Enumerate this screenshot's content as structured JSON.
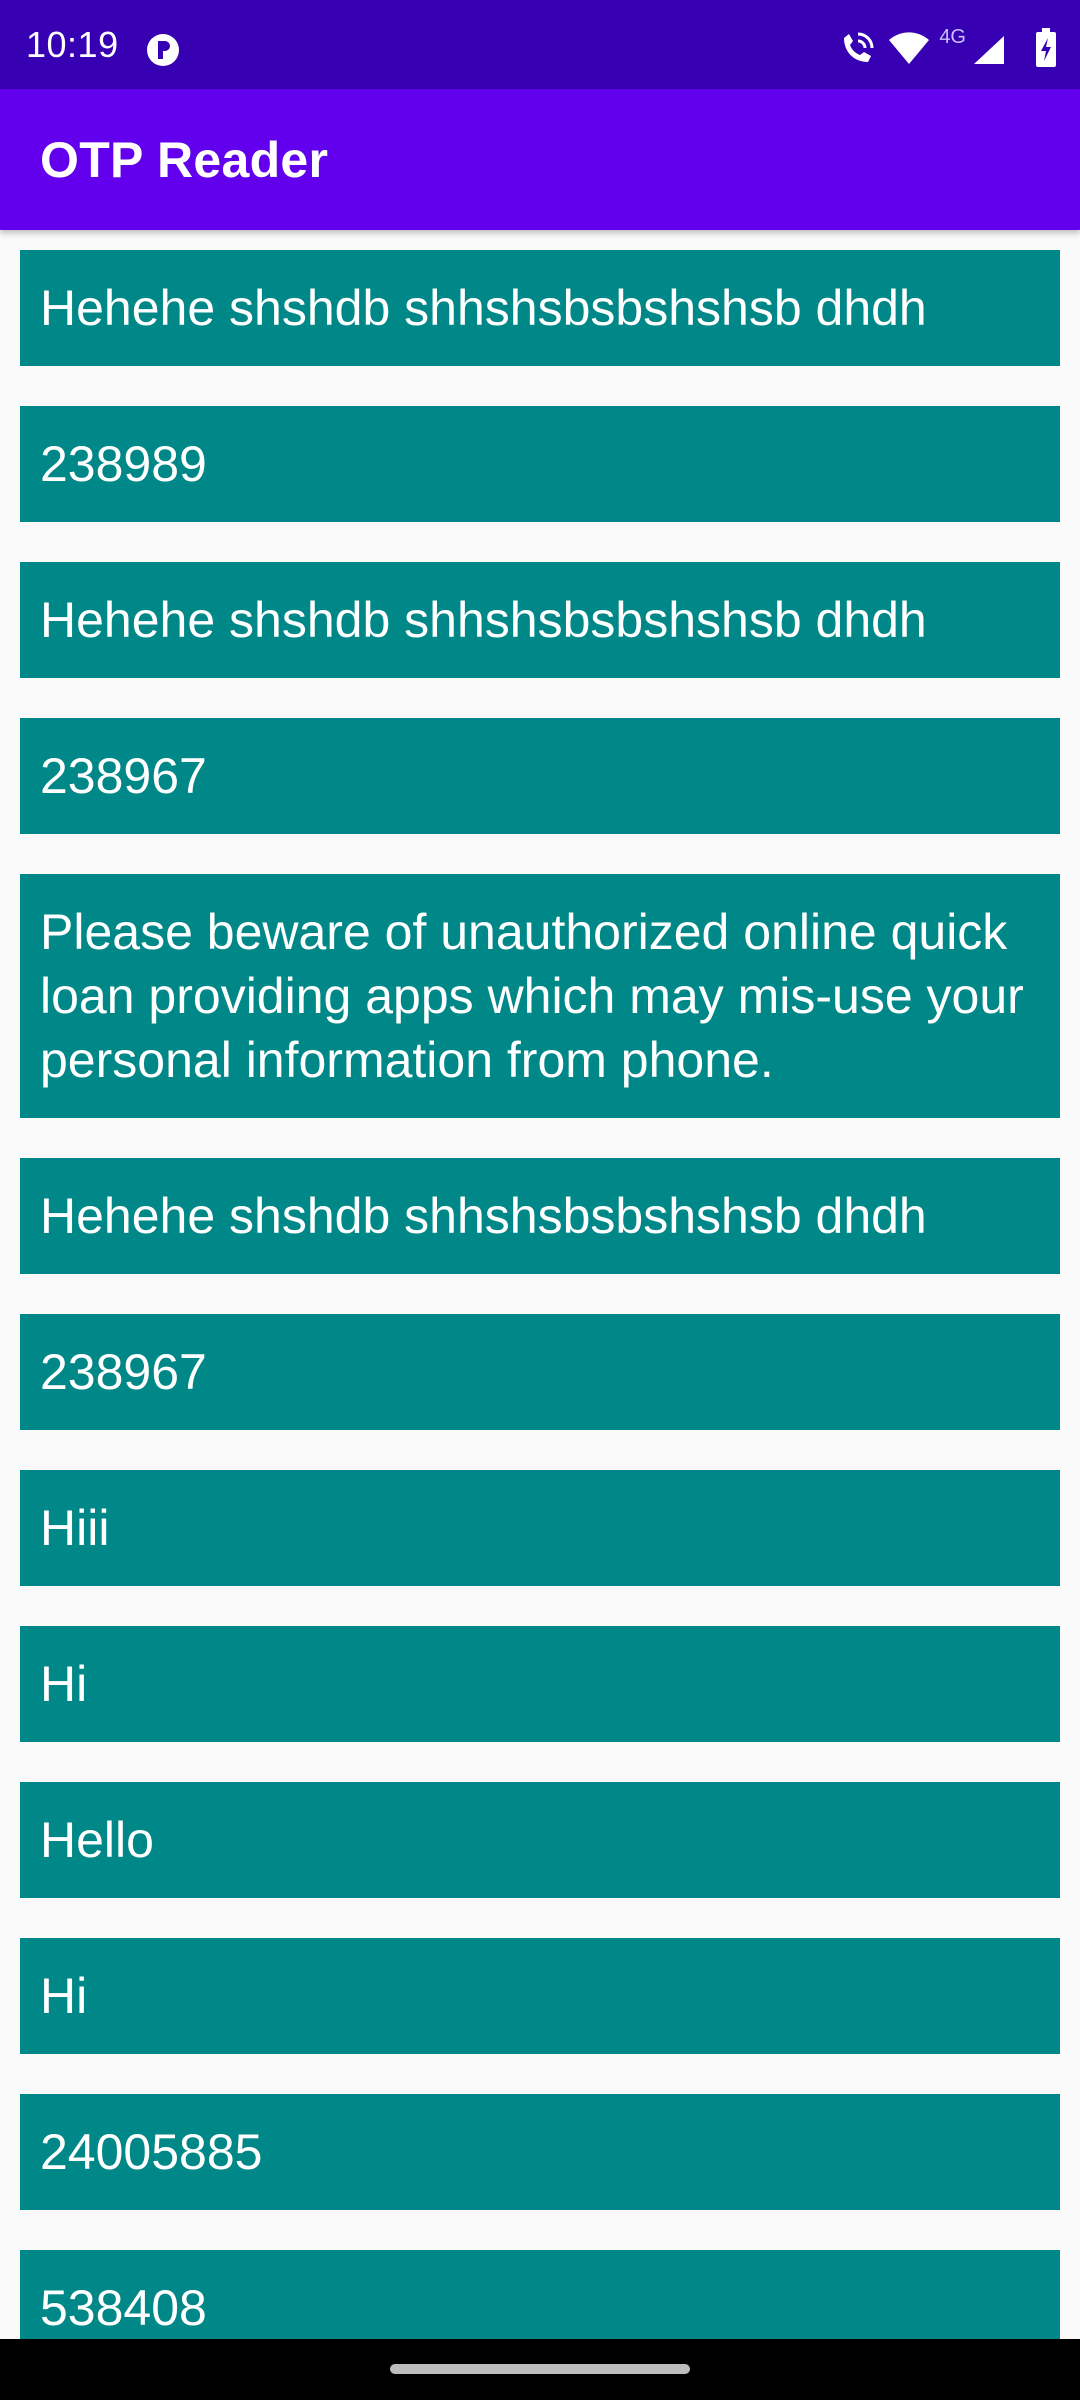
{
  "status_bar": {
    "time": "10:19",
    "network_label": "4G",
    "icons": [
      "play-protect-icon",
      "wifi-calling-icon",
      "wifi-icon",
      "cell-signal-icon",
      "battery-charging-icon"
    ]
  },
  "app_bar": {
    "title": "OTP Reader",
    "background_color": "#6200ee",
    "status_color": "#3700b3"
  },
  "messages": {
    "item_color": "#008888",
    "items": [
      "Hehehe shshdb shhshsbsbshshsb dhdh",
      "238989",
      "Hehehe shshdb shhshsbsbshshsb dhdh",
      "238967",
      "Please beware of unauthorized online quick loan providing apps which may mis-use your personal information from phone.",
      "Hehehe shshdb shhshsbsbshshsb dhdh",
      "238967",
      "Hiii",
      "Hi",
      "Hello",
      "Hi",
      "24005885",
      "538408"
    ]
  }
}
